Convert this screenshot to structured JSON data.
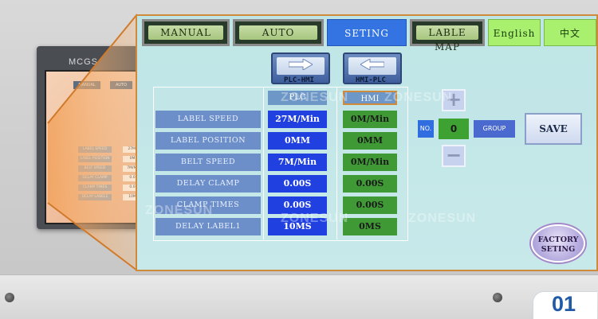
{
  "tabs": [
    {
      "label": "MANUAL",
      "active": false
    },
    {
      "label": "AUTO",
      "active": false
    },
    {
      "label": "SETING",
      "active": true
    },
    {
      "label": "LABLE MAP",
      "active": false
    },
    {
      "label": "English",
      "active": false
    },
    {
      "label": "中文",
      "active": false
    }
  ],
  "transfer": {
    "plc_to_hmi_label": "PLC-HMI",
    "hmi_to_plc_label": "HMI-PLC"
  },
  "table": {
    "columns": {
      "plc": "PLC",
      "hmi": "HMI"
    },
    "rows": [
      {
        "label": "LABEL SPEED",
        "plc": "27M/Min",
        "hmi": "0M/Min"
      },
      {
        "label": "LABEL POSITION",
        "plc": "0MM",
        "hmi": "0MM"
      },
      {
        "label": "BELT SPEED",
        "plc": "7M/Min",
        "hmi": "0M/Min"
      },
      {
        "label": "DELAY CLAMP",
        "plc": "0.00S",
        "hmi": "0.00S"
      },
      {
        "label": "CLAMP TIMES",
        "plc": "0.00S",
        "hmi": "0.00S"
      },
      {
        "label": "DELAY LABEL1",
        "plc": "10MS",
        "hmi": "0MS"
      }
    ]
  },
  "group_control": {
    "plus": "+",
    "minus": "−",
    "no_label": "NO.",
    "no_value": "0",
    "group_label": "GROUP"
  },
  "actions": {
    "save": "SAVE",
    "factory_line1": "FACTORY",
    "factory_line2": "SETING"
  },
  "device": {
    "brand": "MCGS",
    "mini_tabs": [
      "MANUAL",
      "AUTO"
    ],
    "mini_rows": [
      {
        "label": "LABEL SPEED",
        "value": "27M/"
      },
      {
        "label": "LABEL POSITION",
        "value": "0M"
      },
      {
        "label": "BELT SPEED",
        "value": "7M/Mi"
      },
      {
        "label": "DELAY CLAMP",
        "value": "0.0"
      },
      {
        "label": "CLAMP TIMES",
        "value": "0.0"
      },
      {
        "label": "DELAY LABEL1",
        "value": "10M"
      }
    ]
  },
  "watermark": "ZONESUN",
  "page_number": "01",
  "colors": {
    "panel_bg": "#c4e7e8",
    "active_tab": "#3474e2",
    "lang_tab": "#a8f06e",
    "plc_cell": "#2040e0",
    "hmi_cell": "#3f9a36",
    "label_cell": "#6d8fc9",
    "accent_orange": "#e8954a",
    "page_number": "#1e5aa8"
  }
}
